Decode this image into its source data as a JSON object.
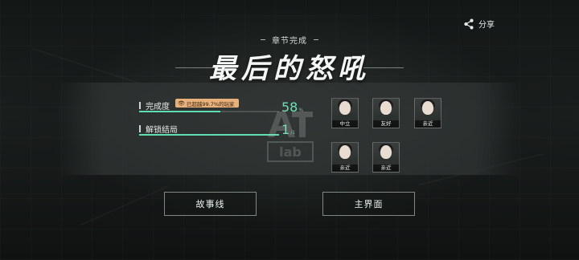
{
  "header": {
    "share_label": "分享",
    "chapter_status": "章节完成",
    "chapter_title": "最后的怒吼"
  },
  "stats": {
    "completion": {
      "label": "完成度",
      "badge": "已超越99.7%的玩家",
      "value": "58",
      "unit": "%",
      "progress": 0.58
    },
    "endings": {
      "label": "解锁结局",
      "value": "1",
      "total": "/1",
      "progress": 1.0
    }
  },
  "characters": [
    {
      "relation": "中立"
    },
    {
      "relation": "友好"
    },
    {
      "relation": "亲近"
    },
    {
      "relation": "亲近"
    },
    {
      "relation": "亲近"
    }
  ],
  "watermark": {
    "text": "AT Lab"
  },
  "buttons": {
    "storyline": "故事线",
    "main_menu": "主界面"
  },
  "colors": {
    "accent": "#5ddfb1",
    "badge_bg": "#e8b07a"
  }
}
